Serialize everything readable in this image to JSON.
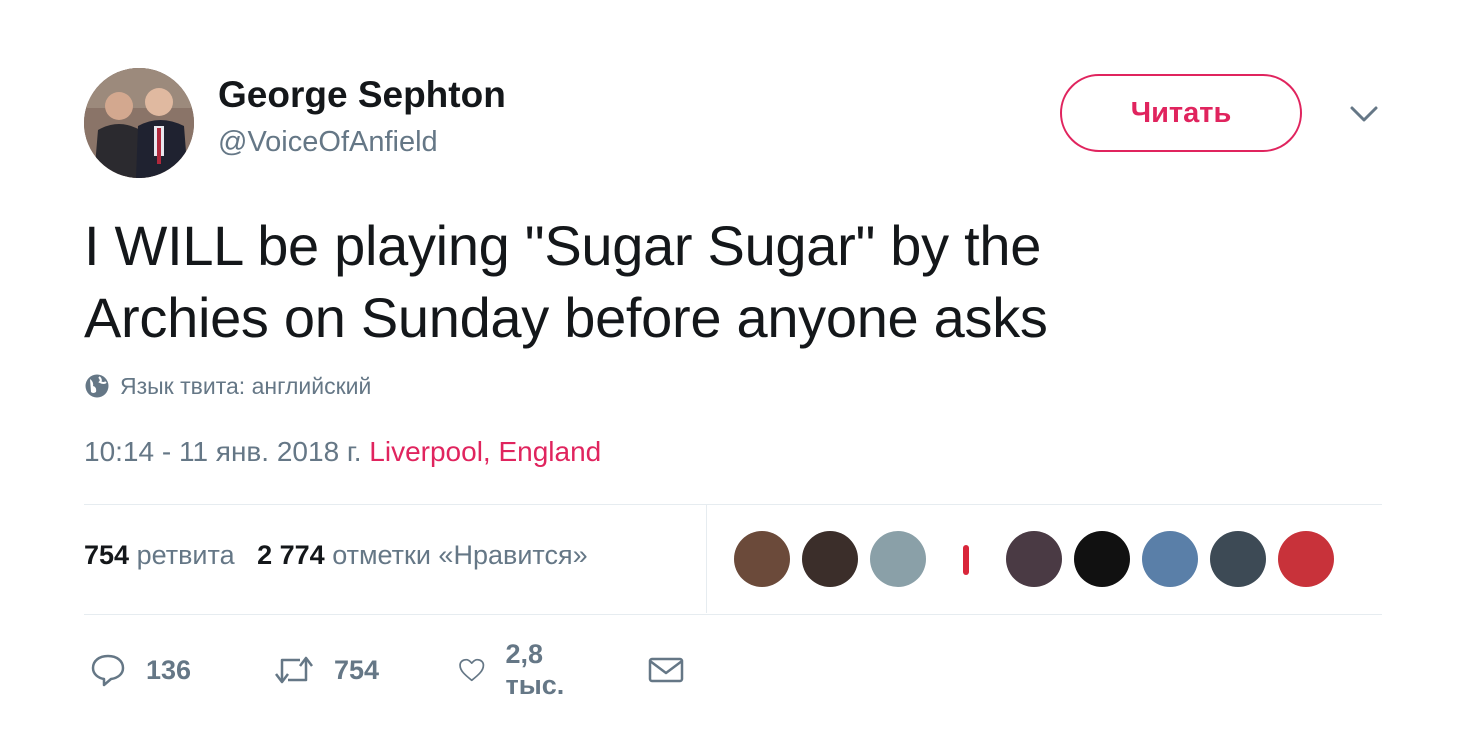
{
  "author": {
    "name": "George Sephton",
    "handle": "@VoiceOfAnfield",
    "avatar_icon": "user-photo-avatar"
  },
  "follow_button": {
    "label": "Читать",
    "color": "#e0245e"
  },
  "menu_icon": "chevron-down-icon",
  "tweet": {
    "text_line1": "I WILL be playing \"Sugar Sugar\" by the",
    "text_line2": "Archies on Sunday before anyone asks"
  },
  "language": {
    "icon": "globe-icon",
    "label": "Язык твита: английский"
  },
  "meta": {
    "timestamp": "10:14 - 11 янв. 2018 г.",
    "location": "Liverpool, England"
  },
  "stats": {
    "retweets_count": "754",
    "retweets_label": "ретвита",
    "likes_count": "2 774",
    "likes_label": "отметки «Нравится»"
  },
  "likers": [
    {
      "name": "liker-avatar-1",
      "color": "#6b4a3a"
    },
    {
      "name": "liker-avatar-2",
      "color": "#3b2e2a"
    },
    {
      "name": "liker-avatar-3",
      "color": "#8aa0a8"
    },
    {
      "name": "liker-avatar-4",
      "color": "#ffffff"
    },
    {
      "name": "liker-avatar-5",
      "color": "#4a3a44"
    },
    {
      "name": "liker-avatar-6",
      "color": "#111111"
    },
    {
      "name": "liker-avatar-7",
      "color": "#5a7fa8"
    },
    {
      "name": "liker-avatar-8",
      "color": "#3d4a55"
    },
    {
      "name": "liker-avatar-9",
      "color": "#c8323a"
    }
  ],
  "actions": {
    "reply_icon": "reply-icon",
    "reply_count": "136",
    "retweet_icon": "retweet-icon",
    "retweet_count": "754",
    "like_icon": "heart-icon",
    "like_count": "2,8 тыс.",
    "dm_icon": "envelope-icon"
  }
}
